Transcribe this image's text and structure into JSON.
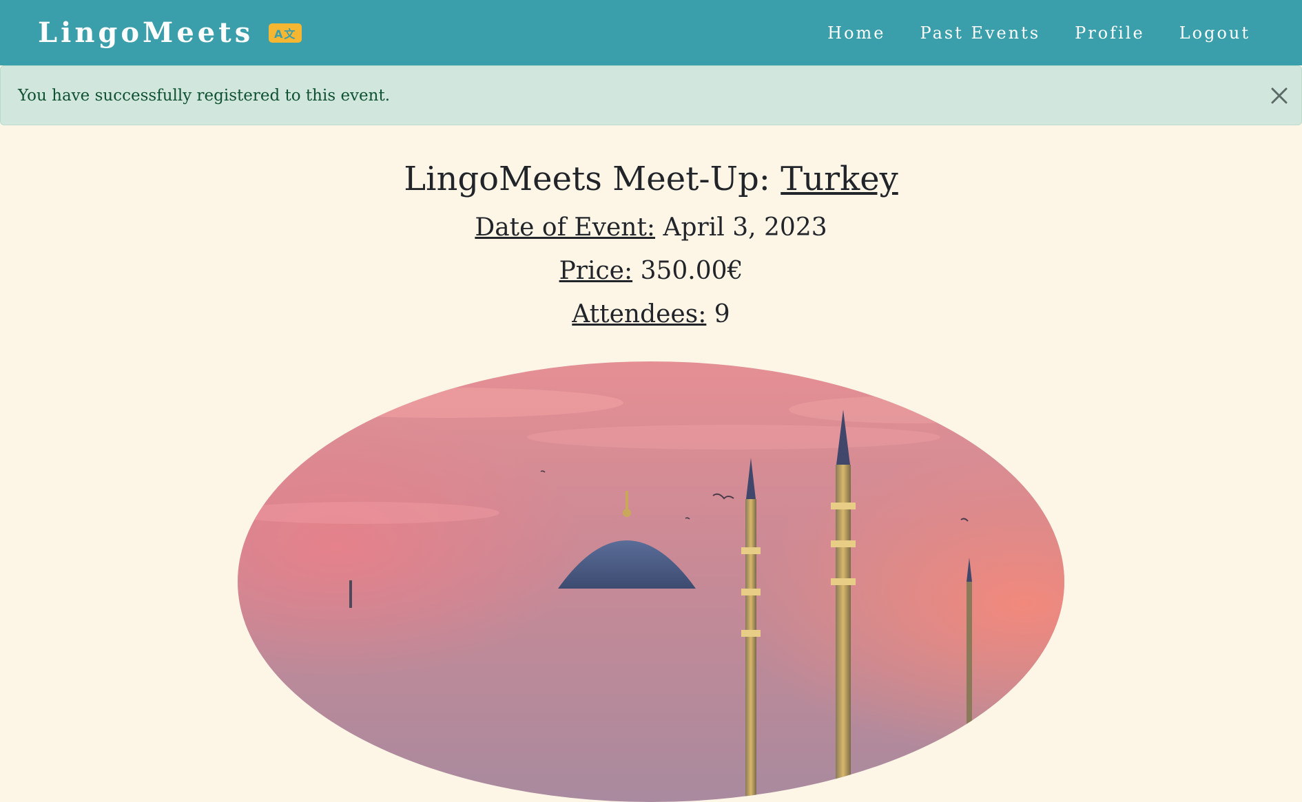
{
  "brand": {
    "name": "LingoMeets",
    "icon": "translate-icon",
    "icon_text": "A文"
  },
  "nav": {
    "items": [
      {
        "label": "Home"
      },
      {
        "label": "Past Events"
      },
      {
        "label": "Profile"
      },
      {
        "label": "Logout"
      }
    ]
  },
  "alert": {
    "message": "You have successfully registered to this event.",
    "close_icon": "close-icon"
  },
  "event": {
    "title_prefix": "LingoMeets Meet-Up:",
    "country": "Turkey",
    "date_label": "Date of Event:",
    "date_value": "April 3, 2023",
    "price_label": "Price:",
    "price_value": "350.00€",
    "attendees_label": "Attendees:",
    "attendees_value": "9"
  },
  "colors": {
    "navbar": "#3a9eab",
    "accent": "#f5b731",
    "alert_bg": "#d1e7dd",
    "alert_text": "#0f5132",
    "page_bg": "#fdf5e6"
  }
}
